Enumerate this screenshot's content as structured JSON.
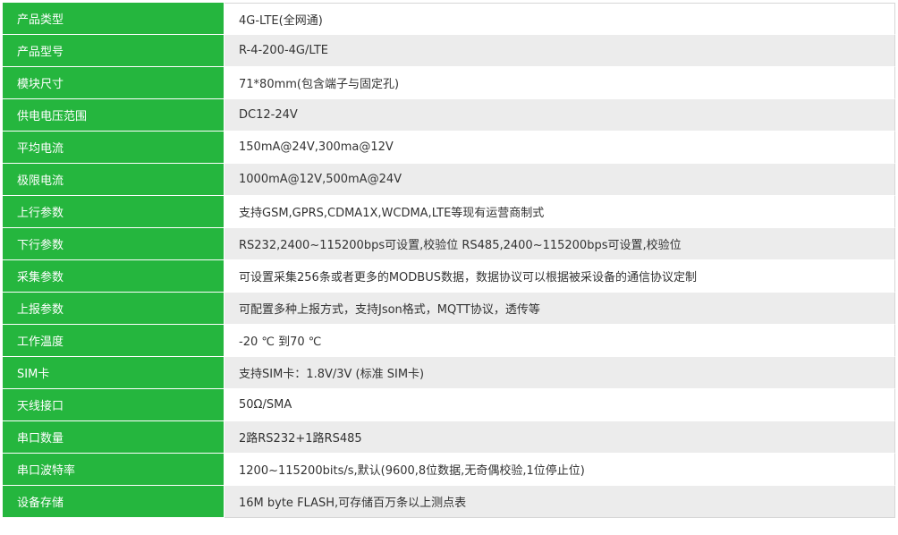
{
  "colors": {
    "label_bg": "#25b63e",
    "label_text": "#ffffff",
    "value_text": "#333333",
    "stripe_light": "#ffffff",
    "stripe_gray": "#ececec"
  },
  "spec_rows": [
    {
      "label": "产品类型",
      "value": "4G-LTE(全网通)"
    },
    {
      "label": "产品型号",
      "value": "R-4-200-4G/LTE"
    },
    {
      "label": "模块尺寸",
      "value": "71*80mm(包含端子与固定孔)"
    },
    {
      "label": "供电电压范围",
      "value": "DC12-24V"
    },
    {
      "label": "平均电流",
      "value": "150mA@24V,300ma@12V"
    },
    {
      "label": "极限电流",
      "value": "1000mA@12V,500mA@24V"
    },
    {
      "label": "上行参数",
      "value": "支持GSM,GPRS,CDMA1X,WCDMA,LTE等现有运营商制式"
    },
    {
      "label": "下行参数",
      "value": "RS232,2400~115200bps可设置,校验位 RS485,2400~115200bps可设置,校验位"
    },
    {
      "label": "采集参数",
      "value": "可设置采集256条或者更多的MODBUS数据，数据协议可以根据被采设备的通信协议定制"
    },
    {
      "label": "上报参数",
      "value": "可配置多种上报方式，支持Json格式，MQTT协议，透传等"
    },
    {
      "label": "工作温度",
      "value": "-20 ℃ 到70 ℃"
    },
    {
      "label": "SIM卡",
      "value": "支持SIM卡：1.8V/3V (标准 SIM卡)"
    },
    {
      "label": "天线接口",
      "value": "50Ω/SMA"
    },
    {
      "label": "串口数量",
      "value": "2路RS232+1路RS485"
    },
    {
      "label": "串口波特率",
      "value": "1200~115200bits/s,默认(9600,8位数据,无奇偶校验,1位停止位)"
    },
    {
      "label": "设备存储",
      "value": "16M byte FLASH,可存储百万条以上测点表"
    }
  ]
}
